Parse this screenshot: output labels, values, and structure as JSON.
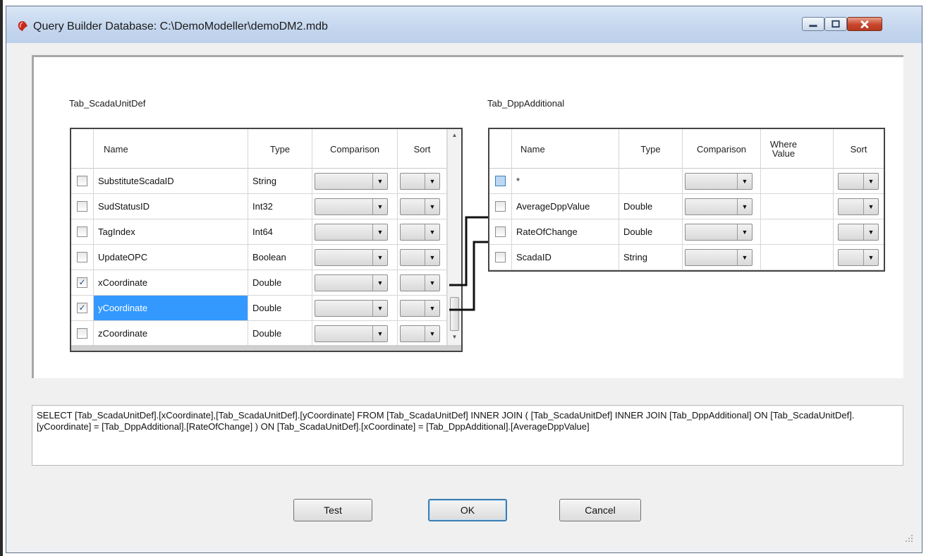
{
  "window": {
    "title": "Query Builder Database: C:\\DemoModeller\\demoDM2.mdb"
  },
  "table1": {
    "name": "Tab_ScadaUnitDef",
    "columns": [
      "Name",
      "Type",
      "Comparison",
      "Sort"
    ],
    "rows": [
      {
        "checked": false,
        "name": "SubstituteScadaID",
        "type": "String"
      },
      {
        "checked": false,
        "name": "SudStatusID",
        "type": "Int32"
      },
      {
        "checked": false,
        "name": "TagIndex",
        "type": "Int64"
      },
      {
        "checked": false,
        "name": "UpdateOPC",
        "type": "Boolean"
      },
      {
        "checked": true,
        "name": "xCoordinate",
        "type": "Double"
      },
      {
        "checked": true,
        "name": "yCoordinate",
        "type": "Double",
        "selected": true
      },
      {
        "checked": false,
        "name": "zCoordinate",
        "type": "Double"
      }
    ]
  },
  "table2": {
    "name": "Tab_DppAdditional",
    "columns": [
      "Name",
      "Type",
      "Comparison",
      "Where Value",
      "Sort"
    ],
    "rows": [
      {
        "checked": false,
        "name": "*",
        "type": ""
      },
      {
        "checked": false,
        "name": "AverageDppValue",
        "type": "Double"
      },
      {
        "checked": false,
        "name": "RateOfChange",
        "type": "Double"
      },
      {
        "checked": false,
        "name": "ScadaID",
        "type": "String"
      }
    ]
  },
  "sql": "SELECT [Tab_ScadaUnitDef].[xCoordinate],[Tab_ScadaUnitDef].[yCoordinate]  FROM  [Tab_ScadaUnitDef] INNER JOIN  ( [Tab_ScadaUnitDef] INNER JOIN [Tab_DppAdditional] ON [Tab_ScadaUnitDef].[yCoordinate] = [Tab_DppAdditional].[RateOfChange] )  ON [Tab_ScadaUnitDef].[xCoordinate] = [Tab_DppAdditional].[AverageDppValue]",
  "buttons": {
    "test": "Test",
    "ok": "OK",
    "cancel": "Cancel"
  },
  "icons": {
    "app": "query-builder-icon",
    "minimize": "minimize-icon",
    "maximize": "maximize-icon",
    "close": "close-icon",
    "dropdown": "chevron-down-icon"
  }
}
